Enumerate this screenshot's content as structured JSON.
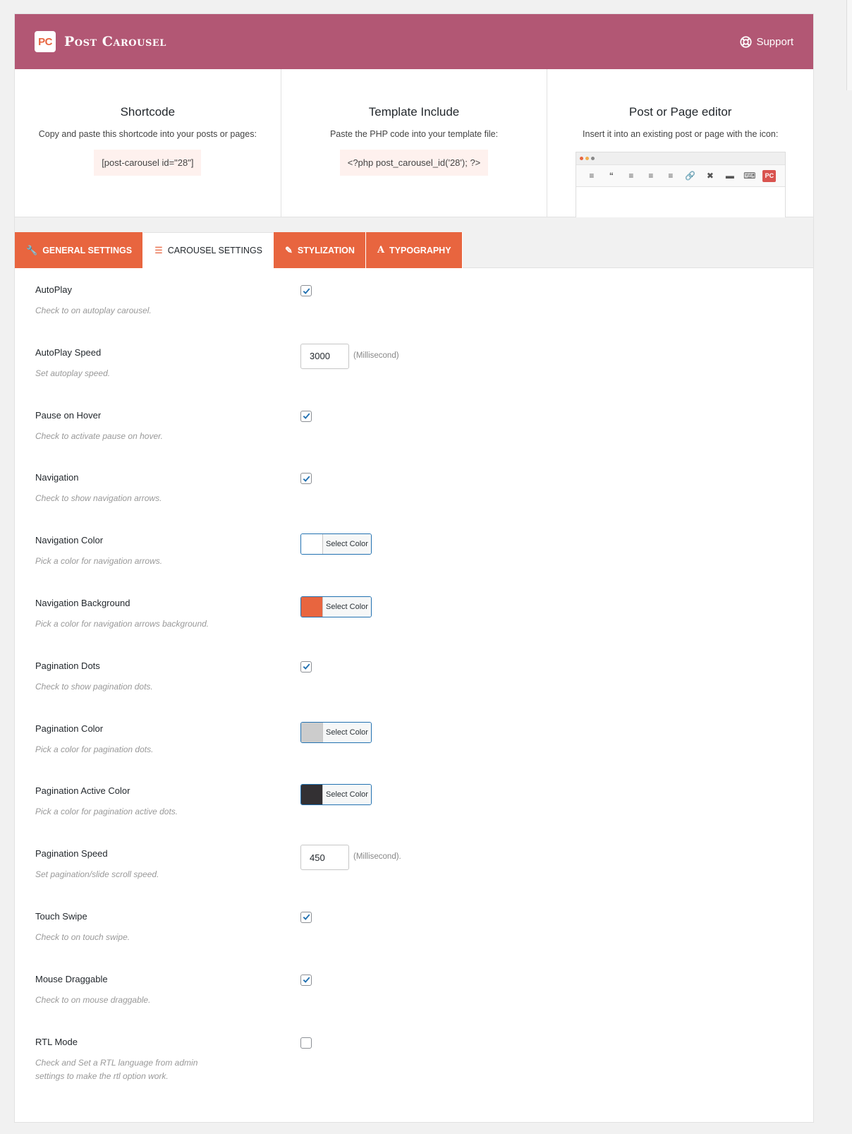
{
  "header": {
    "logo": "PC",
    "title": "Post Carousel",
    "support_label": "Support"
  },
  "info": {
    "shortcode": {
      "title": "Shortcode",
      "text": "Copy and paste this shortcode into your posts or pages:",
      "code": "[post-carousel id=\"28\"]"
    },
    "template": {
      "title": "Template Include",
      "text": "Paste the PHP code into your template file:",
      "code": "<?php post_carousel_id('28'); ?>"
    },
    "editor": {
      "title": "Post or Page editor",
      "text": "Insert it into an existing post or page with the icon:",
      "pc_button": "PC"
    }
  },
  "tabs": [
    {
      "label": "General Settings",
      "icon": "wrench-icon"
    },
    {
      "label": "Carousel Settings",
      "icon": "sliders-icon"
    },
    {
      "label": "Stylization",
      "icon": "brush-icon"
    },
    {
      "label": "Typography",
      "icon": "font-icon"
    }
  ],
  "active_tab": "Carousel Settings",
  "settings": {
    "autoplay": {
      "label": "AutoPlay",
      "desc": "Check to on autoplay carousel.",
      "checked": true
    },
    "autoplay_speed": {
      "label": "AutoPlay Speed",
      "desc": "Set autoplay speed.",
      "value": "3000",
      "unit": "(Millisecond)"
    },
    "pause_on_hover": {
      "label": "Pause on Hover",
      "desc": "Check to activate pause on hover.",
      "checked": true
    },
    "navigation": {
      "label": "Navigation",
      "desc": "Check to show navigation arrows.",
      "checked": true
    },
    "navigation_color": {
      "label": "Navigation Color",
      "desc": "Pick a color for navigation arrows.",
      "color": "#ffffff",
      "button": "Select Color"
    },
    "navigation_background": {
      "label": "Navigation Background",
      "desc": "Pick a color for navigation arrows background.",
      "color": "#e8653f",
      "button": "Select Color"
    },
    "pagination_dots": {
      "label": "Pagination Dots",
      "desc": "Check to show pagination dots.",
      "checked": true
    },
    "pagination_color": {
      "label": "Pagination Color",
      "desc": "Pick a color for pagination dots.",
      "color": "#cccccc",
      "button": "Select Color"
    },
    "pagination_active_color": {
      "label": "Pagination Active Color",
      "desc": "Pick a color for pagination active dots.",
      "color": "#333033",
      "button": "Select Color"
    },
    "pagination_speed": {
      "label": "Pagination Speed",
      "desc": "Set pagination/slide scroll speed.",
      "value": "450",
      "unit": "(Millisecond)."
    },
    "touch_swipe": {
      "label": "Touch Swipe",
      "desc": "Check to on touch swipe.",
      "checked": true
    },
    "mouse_draggable": {
      "label": "Mouse Draggable",
      "desc": "Check to on mouse draggable.",
      "checked": true
    },
    "rtl_mode": {
      "label": "RTL Mode",
      "desc": "Check and Set a RTL language from admin settings to make the rtl option work.",
      "checked": false
    }
  },
  "colors": {
    "header_bg": "#b25774",
    "accent": "#e8653f",
    "checkbox": "#2271b1"
  }
}
